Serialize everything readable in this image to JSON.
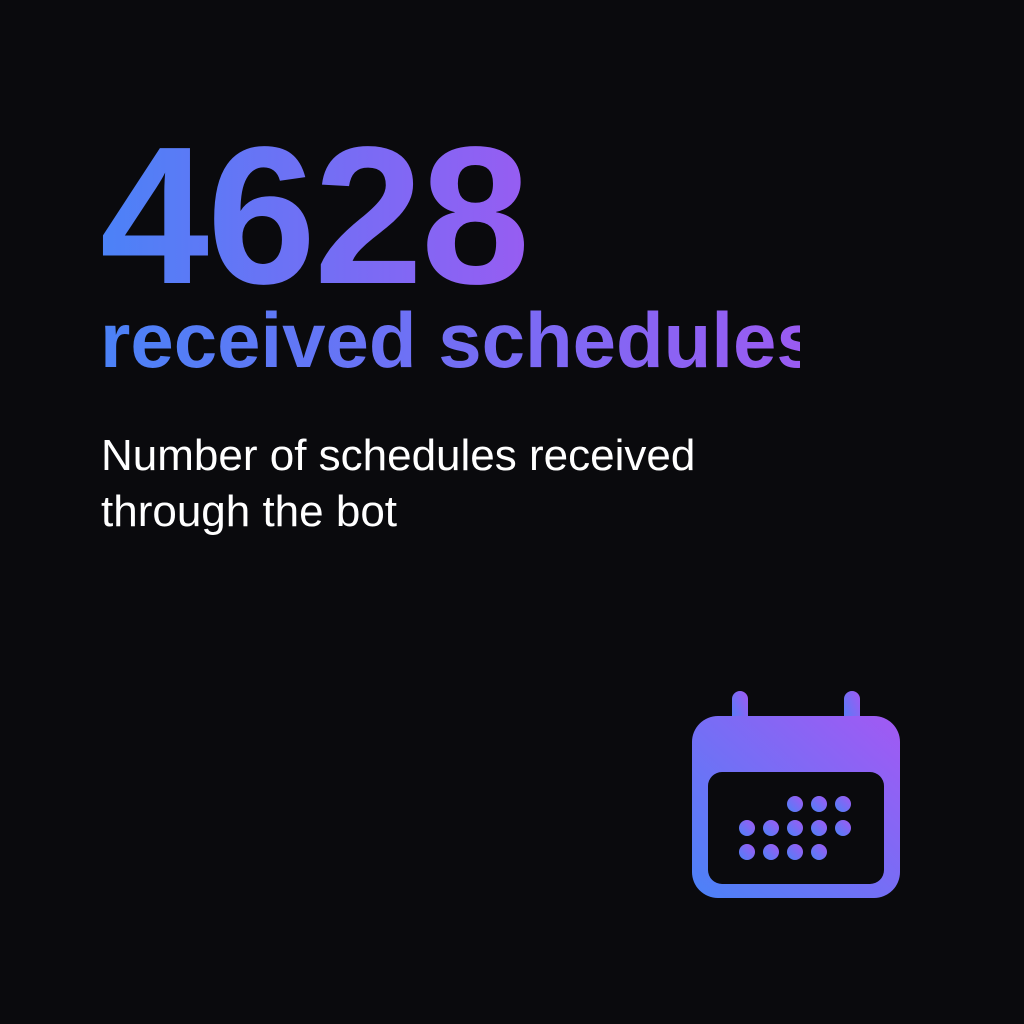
{
  "stat": {
    "value": "4628",
    "label": "received schedules",
    "description": "Number of schedules received through the bot"
  },
  "icon": "calendar-icon",
  "colors": {
    "background": "#0a0a0d",
    "gradient_start": "#4b82f7",
    "gradient_end": "#9a5bf2",
    "description_text": "#ffffff"
  }
}
